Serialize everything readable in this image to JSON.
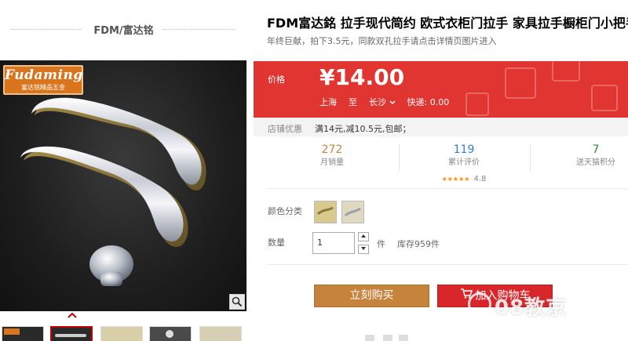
{
  "shop": {
    "name": "FDM/富达铭"
  },
  "logo": {
    "brand": "Fudaming",
    "subtitle": "富达铭精品五金"
  },
  "product": {
    "title": "FDM富达銘 拉手现代简约 欧式衣柜门拉手 家具拉手橱柜门小把手",
    "subtitle": "年终巨献，拍下3.5元，同款双孔拉手请点击详情页图片进入"
  },
  "price": {
    "label": "价格",
    "value": "¥14.00",
    "ship_from": "上海",
    "ship_to_word": "至",
    "ship_to": "长沙",
    "delivery": "快递: 0.00"
  },
  "promo": {
    "label": "店铺优惠",
    "text": "满14元,减10.5元,包邮；"
  },
  "stats": [
    {
      "num": "272",
      "label": "月销量",
      "color": "#c5833c"
    },
    {
      "num": "119",
      "label": "累计评价",
      "color": "#2a7fd4",
      "rating": "4.8",
      "stars": "★★★★★"
    },
    {
      "num": "7",
      "label": "送天猫积分",
      "color": "#2e8b2e"
    }
  ],
  "color_row": {
    "label": "颜色分类"
  },
  "quantity": {
    "label": "数量",
    "value": "1",
    "unit": "件",
    "stock": "库存959件"
  },
  "buttons": {
    "buy": "立刻购买",
    "cart": "加入购物车"
  },
  "watermark": "08教京",
  "icons": {
    "zoom": "search-icon",
    "up_arrow": "chevron-up-icon",
    "cart": "cart-icon"
  }
}
